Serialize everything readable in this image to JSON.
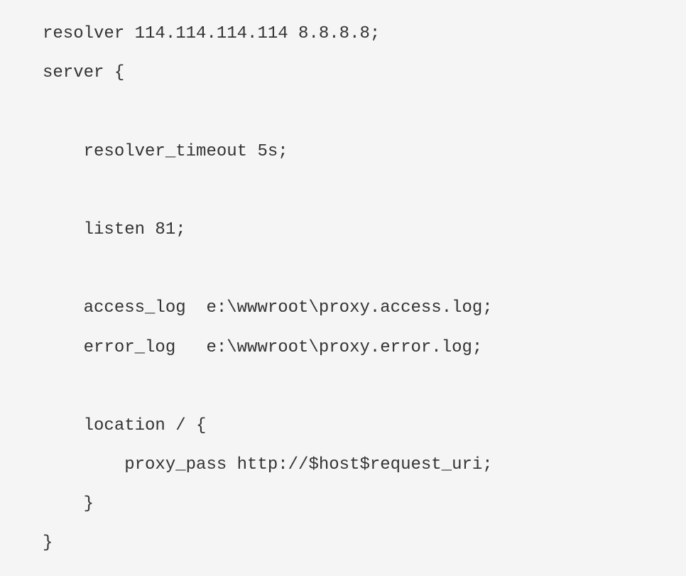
{
  "code": {
    "line1": "resolver 114.114.114.114 8.8.8.8;",
    "line2": "server {",
    "line3": "",
    "line4": "    resolver_timeout 5s;",
    "line5": "",
    "line6": "    listen 81;",
    "line7": "",
    "line8": "    access_log  e:\\wwwroot\\proxy.access.log;",
    "line9": "    error_log   e:\\wwwroot\\proxy.error.log;",
    "line10": "",
    "line11": "    location / {",
    "line12": "        proxy_pass http://$host$request_uri;",
    "line13": "    }",
    "line14": "}"
  }
}
